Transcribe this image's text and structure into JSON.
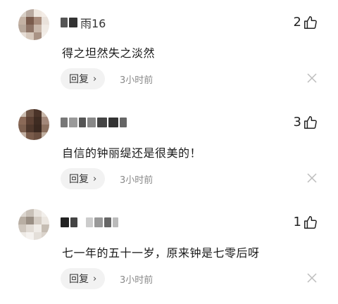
{
  "comments": [
    {
      "username": "雨16",
      "likes": "2",
      "text": "得之坦然失之淡然",
      "reply_label": "回复",
      "time": "3小时前",
      "avatar_colors": [
        "#d8cfc6",
        "#b9aaa0",
        "#efe7df",
        "#f3ece6",
        "#c4b2a4",
        "#7a5b4c",
        "#a88c7c",
        "#e9e1da",
        "#b7a79a",
        "#8e7466",
        "#c9b8ab",
        "#f0eae4",
        "#e6ddd5",
        "#d7c9bd",
        "#a99385",
        "#f2ede8"
      ]
    },
    {
      "username": "",
      "likes": "3",
      "text": "自信的钟丽缇还是很美的！",
      "reply_label": "回复",
      "time": "3小时前",
      "avatar_colors": [
        "#cbbdb1",
        "#6f5546",
        "#4a3328",
        "#c7b6a8",
        "#8b6a58",
        "#5c4033",
        "#3f2c22",
        "#a3887a",
        "#7d604f",
        "#4e372b",
        "#3a281f",
        "#8c705f",
        "#c2b0a3",
        "#7a5c4b",
        "#6b4f40",
        "#bfae9f"
      ]
    },
    {
      "username": "",
      "likes": "1",
      "text": "七一年的五十一岁，原来钟是七零后呀",
      "reply_label": "回复",
      "time": "3小时前",
      "avatar_colors": [
        "#dcd6cf",
        "#c9c1b8",
        "#e8e3dd",
        "#f2efeb",
        "#b8aea3",
        "#9a8f84",
        "#d4ccc3",
        "#ebe6e0",
        "#cfc7be",
        "#e1dbd4",
        "#f0ece7",
        "#c6bdb3",
        "#eeeae5",
        "#f5f2ef",
        "#e4dfd9",
        "#dad3cb"
      ]
    }
  ],
  "colors": {
    "reply_bg": "#f2f2f2",
    "time_text": "#888888"
  }
}
